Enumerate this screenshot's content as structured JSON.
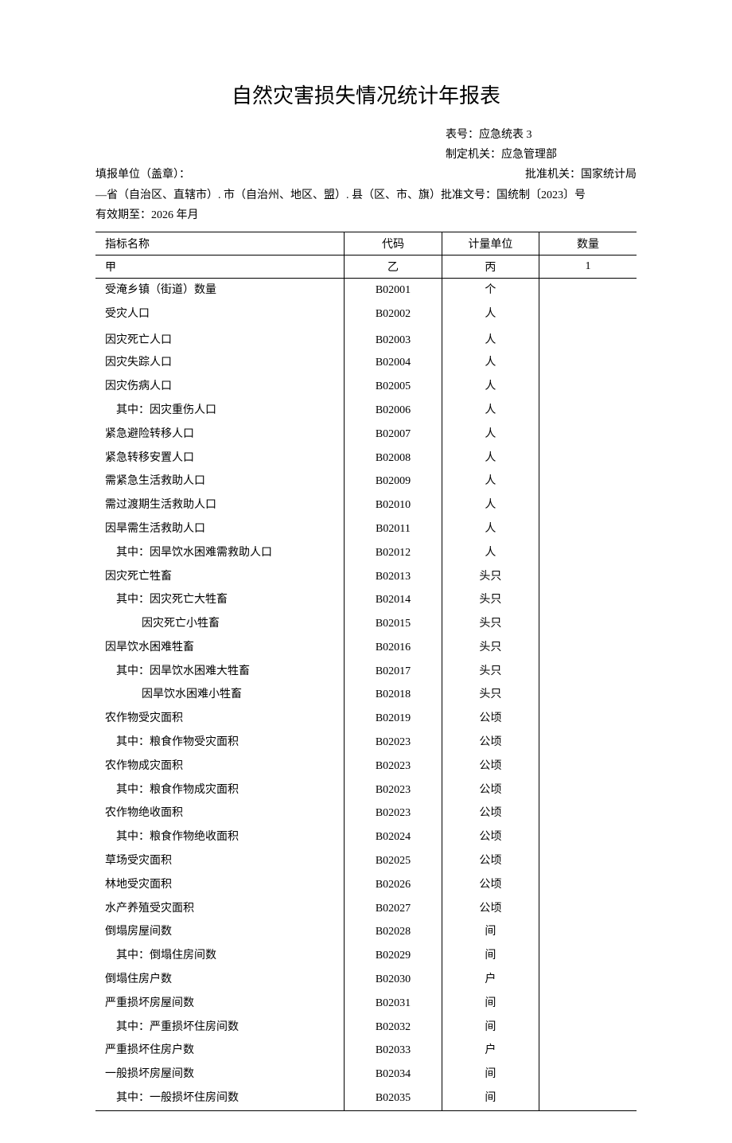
{
  "title": "自然灾害损失情况统计年报表",
  "meta": {
    "form_no_label": "表号：",
    "form_no": "应急统表 3",
    "authority_label": "制定机关：",
    "authority": "应急管理部",
    "reporter_label": "填报单位（盖章）：",
    "approval_org_label": "批准机关：",
    "approval_org": "国家统计局",
    "region_line": "—省（自治区、直辖市）. 市（自治州、地区、盟）. 县（区、市、旗）批准文号：国统制〔2023〕号",
    "valid_until_label": "有效期至：",
    "valid_until": "2026 年月"
  },
  "headers": {
    "name": "指标名称",
    "code": "代码",
    "unit": "计量单位",
    "qty": "数量",
    "name_sub": "甲",
    "code_sub": "乙",
    "unit_sub": "丙",
    "qty_sub": "1"
  },
  "rows": [
    {
      "name": "受淹乡镇（街道）数量",
      "code": "B02001",
      "unit": "个",
      "indent": 0
    },
    {
      "name": "受灾人口",
      "code": "B02002",
      "unit": "人",
      "indent": 0
    },
    {
      "name": "因灾死亡人口",
      "code": "B02003",
      "unit": "人",
      "indent": 0,
      "spacer": true
    },
    {
      "name": "因灾失踪人口",
      "code": "B02004",
      "unit": "人",
      "indent": 0
    },
    {
      "name": "因灾伤病人口",
      "code": "B02005",
      "unit": "人",
      "indent": 0
    },
    {
      "name": "其中：因灾重伤人口",
      "code": "B02006",
      "unit": "人",
      "indent": 1
    },
    {
      "name": "紧急避险转移人口",
      "code": "B02007",
      "unit": "人",
      "indent": 0
    },
    {
      "name": "紧急转移安置人口",
      "code": "B02008",
      "unit": "人",
      "indent": 0
    },
    {
      "name": "需紧急生活救助人口",
      "code": "B02009",
      "unit": "人",
      "indent": 0
    },
    {
      "name": "需过渡期生活救助人口",
      "code": "B02010",
      "unit": "人",
      "indent": 0
    },
    {
      "name": "因旱需生活救助人口",
      "code": "B02011",
      "unit": "人",
      "indent": 0
    },
    {
      "name": "其中：因旱饮水困难需救助人口",
      "code": "B02012",
      "unit": "人",
      "indent": 1
    },
    {
      "name": "因灾死亡牲畜",
      "code": "B02013",
      "unit": "头只",
      "indent": 0
    },
    {
      "name": "其中：因灾死亡大牲畜",
      "code": "B02014",
      "unit": "头只",
      "indent": 1
    },
    {
      "name": "因灾死亡小牲畜",
      "code": "B02015",
      "unit": "头只",
      "indent": 2
    },
    {
      "name": "因旱饮水困难牲畜",
      "code": "B02016",
      "unit": "头只",
      "indent": 0
    },
    {
      "name": "其中：因旱饮水困难大牲畜",
      "code": "B02017",
      "unit": "头只",
      "indent": 1
    },
    {
      "name": "因旱饮水困难小牲畜",
      "code": "B02018",
      "unit": "头只",
      "indent": 2
    },
    {
      "name": "农作物受灾面积",
      "code": "B02019",
      "unit": "公顷",
      "indent": 0
    },
    {
      "name": "其中：粮食作物受灾面积",
      "code": "B02023",
      "unit": "公顷",
      "indent": 1
    },
    {
      "name": "农作物成灾面积",
      "code": "B02023",
      "unit": "公顷",
      "indent": 0
    },
    {
      "name": "其中：粮食作物成灾面积",
      "code": "B02023",
      "unit": "公顷",
      "indent": 1
    },
    {
      "name": "农作物绝收面积",
      "code": "B02023",
      "unit": "公顷",
      "indent": 0
    },
    {
      "name": "其中：粮食作物绝收面积",
      "code": "B02024",
      "unit": "公顷",
      "indent": 1
    },
    {
      "name": "草场受灾面积",
      "code": "B02025",
      "unit": "公顷",
      "indent": 0
    },
    {
      "name": "林地受灾面积",
      "code": "B02026",
      "unit": "公顷",
      "indent": 0
    },
    {
      "name": "水产养殖受灾面积",
      "code": "B02027",
      "unit": "公顷",
      "indent": 0
    },
    {
      "name": "倒塌房屋间数",
      "code": "B02028",
      "unit": "间",
      "indent": 0
    },
    {
      "name": "其中：倒塌住房间数",
      "code": "B02029",
      "unit": "间",
      "indent": 1
    },
    {
      "name": "倒塌住房户数",
      "code": "B02030",
      "unit": "户",
      "indent": 0
    },
    {
      "name": "严重损坏房屋间数",
      "code": "B02031",
      "unit": "间",
      "indent": 0
    },
    {
      "name": "其中：严重损坏住房间数",
      "code": "B02032",
      "unit": "间",
      "indent": 1
    },
    {
      "name": "严重损坏住房户数",
      "code": "B02033",
      "unit": "户",
      "indent": 0
    },
    {
      "name": "一般损坏房屋间数",
      "code": "B02034",
      "unit": "间",
      "indent": 0
    },
    {
      "name": "其中：一般损坏住房间数",
      "code": "B02035",
      "unit": "间",
      "indent": 1
    }
  ]
}
